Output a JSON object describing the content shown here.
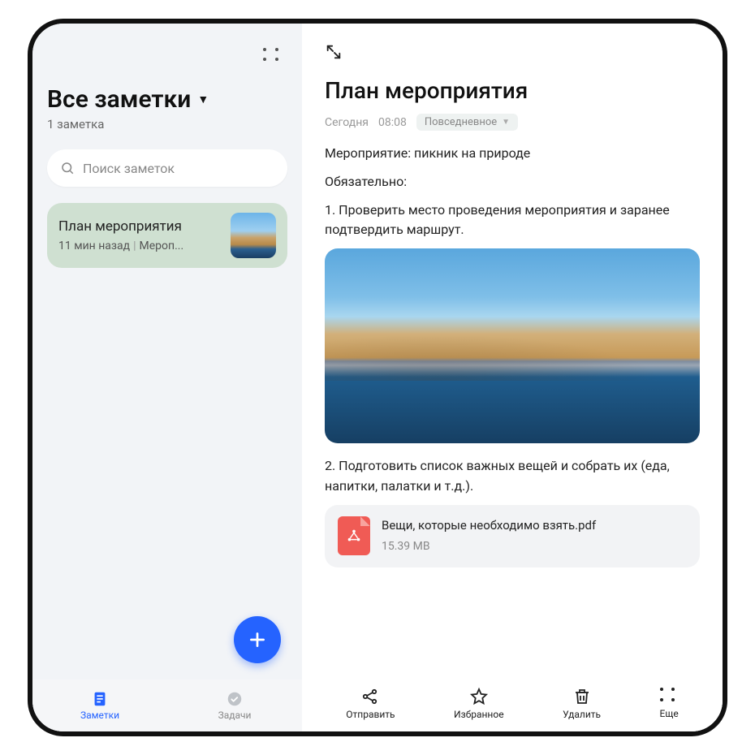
{
  "left": {
    "heading": "Все заметки",
    "count_label": "1 заметка",
    "search_placeholder": "Поиск заметок",
    "note": {
      "title": "План мероприятия",
      "time": "11 мин назад",
      "preview": "Мероп..."
    },
    "nav": {
      "notes": "Заметки",
      "tasks": "Задачи"
    }
  },
  "right": {
    "title": "План мероприятия",
    "date_label": "Сегодня",
    "time": "08:08",
    "tag": "Повседневное",
    "para1": "Мероприятие: пикник на природе",
    "para2": "Обязательно:",
    "para3": "1. Проверить место проведения мероприятия и заранее подтвердить маршрут.",
    "para4": "2. Подготовить список важных вещей и собрать их (еда, напитки, палатки и т.д.).",
    "attachment": {
      "name": "Вещи, которые необходимо взять.pdf",
      "size": "15.39 MB"
    },
    "actions": {
      "send": "Отправить",
      "favorite": "Избранное",
      "delete": "Удалить",
      "more": "Еще"
    }
  }
}
